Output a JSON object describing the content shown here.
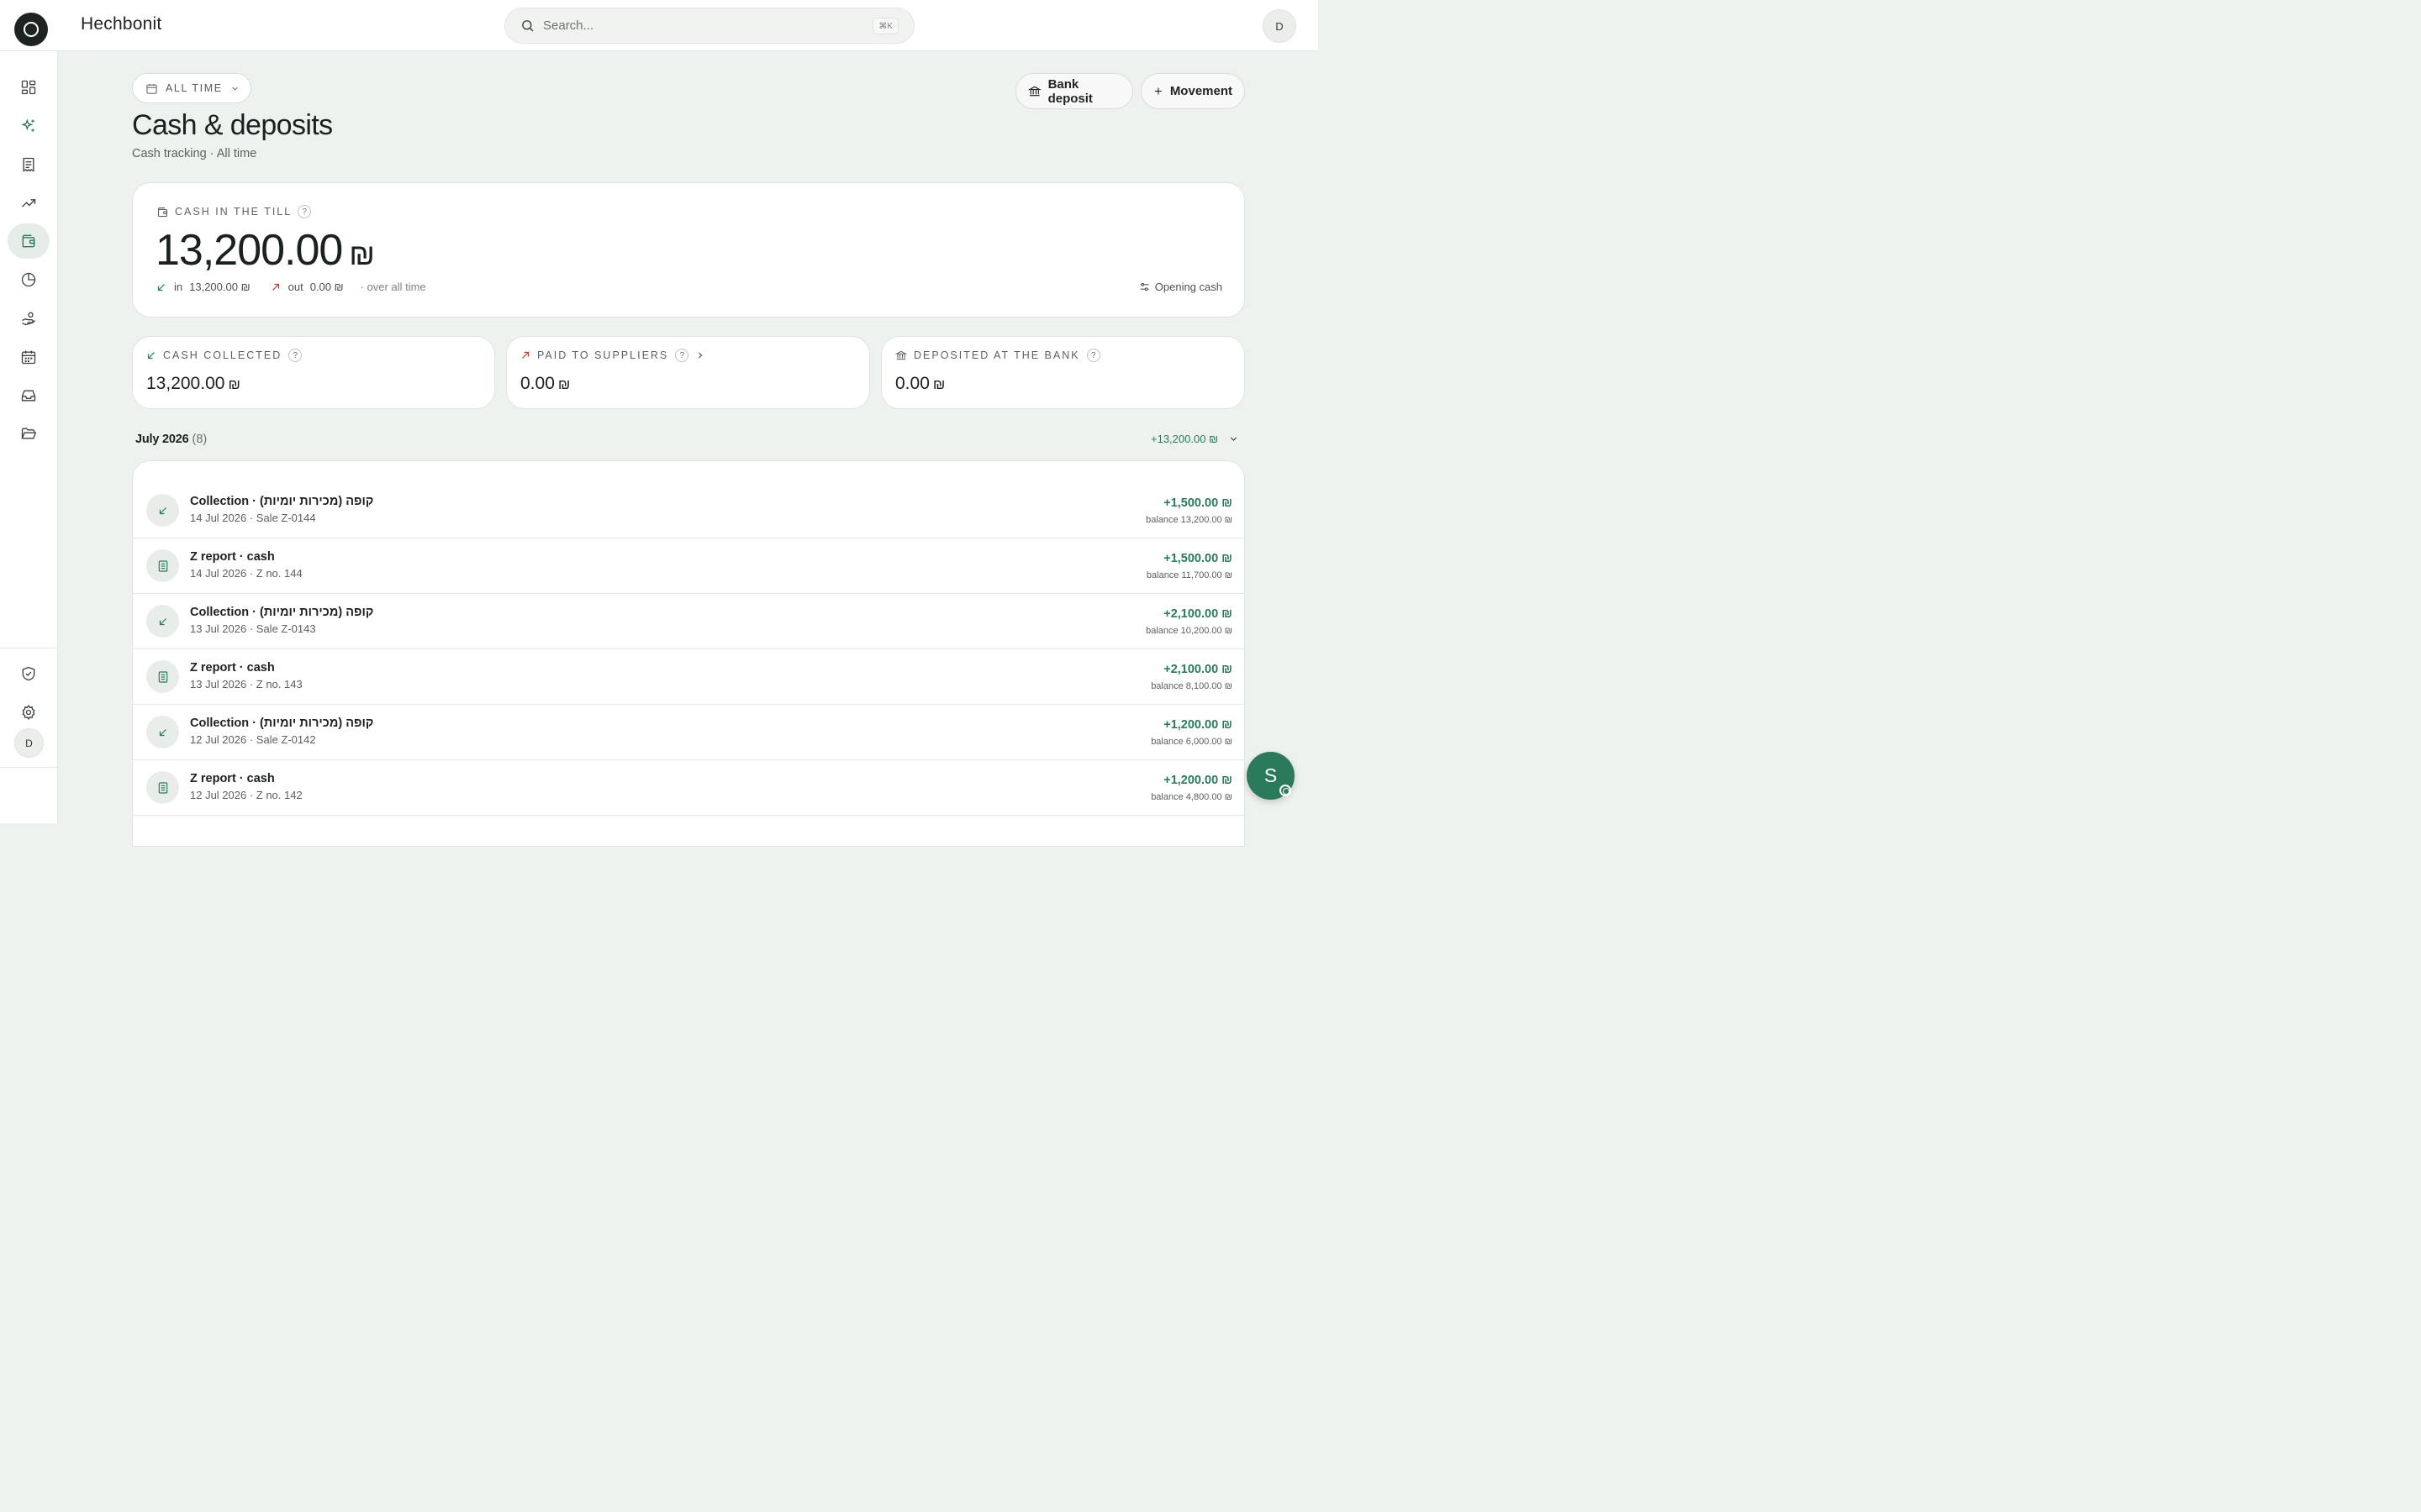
{
  "app": {
    "name": "Hechbonit"
  },
  "search": {
    "placeholder": "Search...",
    "shortcut": "⌘K"
  },
  "user": {
    "initial": "D"
  },
  "sidebar": {
    "items": [
      {
        "icon": "dashboard-icon"
      },
      {
        "icon": "sparkle-icon"
      },
      {
        "icon": "receipt-icon"
      },
      {
        "icon": "trend-up-icon"
      },
      {
        "icon": "wallet-icon",
        "active": true
      },
      {
        "icon": "pie-chart-icon"
      },
      {
        "icon": "hand-coins-icon"
      },
      {
        "icon": "calendar-icon"
      },
      {
        "icon": "inbox-icon"
      },
      {
        "icon": "folder-open-icon"
      }
    ],
    "bottom": [
      {
        "icon": "shield-check-icon"
      },
      {
        "icon": "gear-icon"
      }
    ]
  },
  "header": {
    "period": "ALL TIME",
    "title": "Cash & deposits",
    "subtitle": "Cash tracking · All time",
    "bank_deposit_label": "Bank deposit",
    "movement_label": "Movement"
  },
  "till": {
    "label": "CASH IN THE TILL",
    "help": "?",
    "amount": "13,200.00",
    "currency": "₪",
    "in_label": "in",
    "in_amount": "13,200.00 ₪",
    "out_label": "out",
    "out_amount": "0.00 ₪",
    "note": "· over all time",
    "opening_label": "Opening cash"
  },
  "stats": [
    {
      "label": "CASH COLLECTED",
      "help": "?",
      "value": "13,200.00",
      "currency": "₪"
    },
    {
      "label": "PAID TO SUPPLIERS",
      "help": "?",
      "value": "0.00",
      "currency": "₪"
    },
    {
      "label": "DEPOSITED AT THE BANK",
      "help": "?",
      "value": "0.00",
      "currency": "₪"
    }
  ],
  "month": {
    "label": "July 2026",
    "count": "(8)",
    "total": "+13,200.00 ₪"
  },
  "transactions": [
    {
      "kind": "collection",
      "title": "Collection · קופה (מכירות יומיות)",
      "sub": "14 Jul 2026 · Sale Z-0144",
      "amount": "+1,500.00 ₪",
      "balance": "balance 13,200.00 ₪"
    },
    {
      "kind": "zreport",
      "title": "Z report · cash",
      "sub": "14 Jul 2026 · Z no. 144",
      "amount": "+1,500.00 ₪",
      "balance": "balance 11,700.00 ₪"
    },
    {
      "kind": "collection",
      "title": "Collection · קופה (מכירות יומיות)",
      "sub": "13 Jul 2026 · Sale Z-0143",
      "amount": "+2,100.00 ₪",
      "balance": "balance 10,200.00 ₪"
    },
    {
      "kind": "zreport",
      "title": "Z report · cash",
      "sub": "13 Jul 2026 · Z no. 143",
      "amount": "+2,100.00 ₪",
      "balance": "balance 8,100.00 ₪"
    },
    {
      "kind": "collection",
      "title": "Collection · קופה (מכירות יומיות)",
      "sub": "12 Jul 2026 · Sale Z-0142",
      "amount": "+1,200.00 ₪",
      "balance": "balance 6,000.00 ₪"
    },
    {
      "kind": "zreport",
      "title": "Z report · cash",
      "sub": "12 Jul 2026 · Z no. 142",
      "amount": "+1,200.00 ₪",
      "balance": "balance 4,800.00 ₪"
    }
  ],
  "assistant": {
    "initial": "S"
  },
  "colors": {
    "accent": "#2a7a5b",
    "out": "#c0392b",
    "bg": "#eef2ef"
  }
}
